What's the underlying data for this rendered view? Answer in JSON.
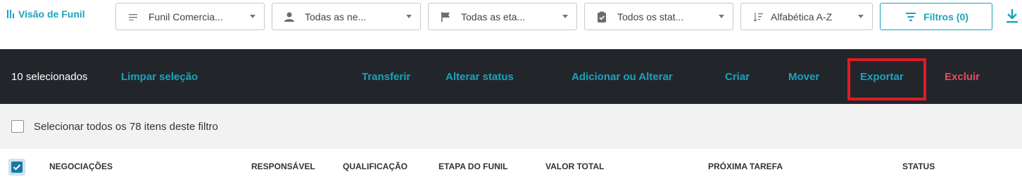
{
  "header": {
    "view_title": "Visão de Funil",
    "filters": {
      "funnel": "Funil Comercia...",
      "negotiations": "Todas as ne...",
      "stages": "Todas as eta...",
      "statuses": "Todos os stat...",
      "sort": "Alfabética A-Z",
      "filters_button": "Filtros (0)"
    }
  },
  "action_bar": {
    "selected_count": "10 selecionados",
    "clear_selection": "Limpar seleção",
    "actions": {
      "transfer": "Transferir",
      "change_status": "Alterar status",
      "add_or_change": "Adicionar ou Alterar",
      "create": "Criar",
      "move": "Mover",
      "export": "Exportar",
      "delete": "Excluir"
    }
  },
  "select_all": {
    "label": "Selecionar todos os 78 itens deste filtro"
  },
  "table": {
    "columns": {
      "negotiations": "NEGOCIAÇÕES",
      "responsible": "RESPONSÁVEL",
      "qualification": "QUALIFICAÇÃO",
      "stage": "ETAPA DO FUNIL",
      "total_value": "VALOR TOTAL",
      "next_task": "PRÓXIMA TAREFA",
      "status": "STATUS"
    }
  },
  "colors": {
    "accent": "#19a3bd",
    "action_bar_bg": "#22262b",
    "danger": "#e84a63",
    "highlight": "#e01b24"
  },
  "icons": {
    "view": "funnel-bars-icon",
    "funnel_filter": "lines-icon",
    "negotiations_filter": "person-icon",
    "stages_filter": "flag-icon",
    "status_filter": "clipboard-check-icon",
    "sort": "sort-icon",
    "filters": "filter-icon",
    "download": "download-icon"
  }
}
